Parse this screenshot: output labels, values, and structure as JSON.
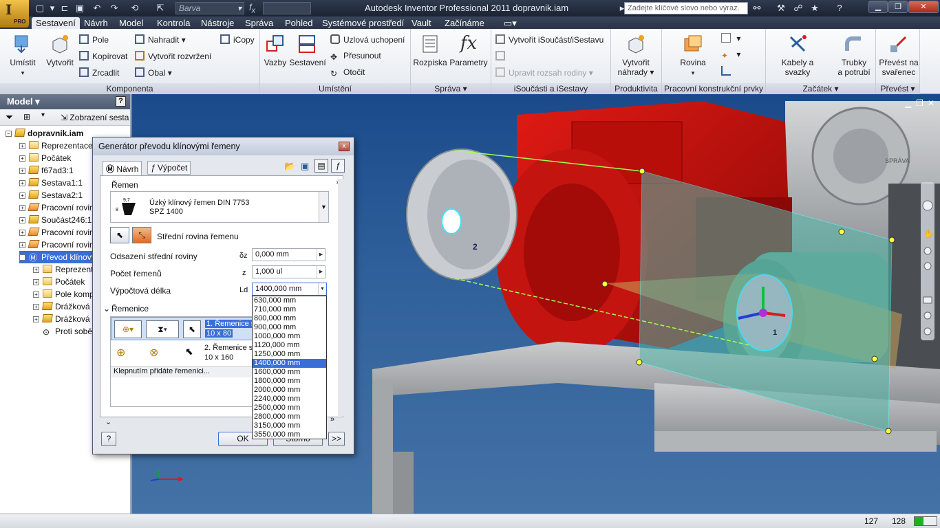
{
  "titlebar": {
    "title": "Autodesk Inventor Professional 2011   dopravnik.iam",
    "app_badge": "PRO",
    "color_field": "Barva",
    "search_placeholder": "Zadejte klíčové slovo nebo výraz."
  },
  "ribbon_tabs": [
    "Sestavení",
    "Návrh",
    "Model",
    "Kontrola",
    "Nástroje",
    "Správa",
    "Pohled",
    "Systémové prostředí",
    "Vault",
    "Začínáme"
  ],
  "ribbon": {
    "komponenta": {
      "label": "Komponenta",
      "umistit": "Umístit",
      "vytvorit": "Vytvořit",
      "pole": "Pole",
      "kopirovat": "Kopírovat",
      "zrcadlit": "Zrcadlit",
      "nahradit": "Nahradit",
      "vytvorit_rozvrzeni": "Vytvořit rozvržení",
      "obal": "Obal",
      "icopy": "iCopy"
    },
    "umisteni": {
      "label": "Umístění",
      "vazby": "Vazby",
      "sestaveni": "Sestavení",
      "uzlova": "Uzlová uchopení",
      "presunout": "Přesunout",
      "otocit": "Otočit"
    },
    "sprava": {
      "label": "Správa",
      "rozpiska": "Rozpiska",
      "parametry": "Parametry"
    },
    "isoucasti": {
      "label": "iSoučásti a iSestavy",
      "vytvorit": "Vytvořit iSoučást/iSestavu",
      "upravit": "Upravit rozsah rodiny"
    },
    "produktivita": {
      "label": "Produktivita",
      "vytvorit_nahrady_1": "Vytvořit",
      "vytvorit_nahrady_2": "náhrady"
    },
    "pracovni": {
      "label": "Pracovní konstrukční prvky",
      "rovina": "Rovina"
    },
    "zacatek": {
      "label": "Začátek",
      "kabely": "Kabely a svazky",
      "trubky_1": "Trubky",
      "trubky_2": "a potrubí"
    },
    "prevest": {
      "label": "Převést",
      "prevest_1": "Převést na",
      "prevest_2": "svařenec"
    }
  },
  "browser": {
    "title": "Model",
    "help": "?",
    "toolbar_view": "Zobrazení sesta",
    "tree": [
      {
        "label": "dopravnik.iam",
        "icon": "assembly-icon",
        "level": 0,
        "expander": "minus",
        "bold": true
      },
      {
        "label": "Reprezentace",
        "icon": "folder-icon",
        "level": 1,
        "expander": "plus"
      },
      {
        "label": "Počátek",
        "icon": "folder-icon",
        "level": 1,
        "expander": "plus"
      },
      {
        "label": "f67ad3:1",
        "icon": "part-icon",
        "level": 1,
        "expander": "plus"
      },
      {
        "label": "Sestava1:1",
        "icon": "subassembly-icon",
        "level": 1,
        "expander": "plus"
      },
      {
        "label": "Sestava2:1",
        "icon": "subassembly-icon",
        "level": 1,
        "expander": "plus"
      },
      {
        "label": "Pracovní rovina1",
        "icon": "plane-icon",
        "level": 1,
        "expander": "plus"
      },
      {
        "label": "Součást246:1",
        "icon": "part-icon",
        "level": 1,
        "expander": "plus"
      },
      {
        "label": "Pracovní rovina4",
        "icon": "plane-icon",
        "level": 1,
        "expander": "plus"
      },
      {
        "label": "Pracovní rovina5",
        "icon": "plane-icon",
        "level": 1,
        "expander": "plus"
      },
      {
        "label": "Převod klínovým ř",
        "icon": "design-accelerator-icon",
        "level": 1,
        "expander": "minus",
        "selected": true
      },
      {
        "label": "Reprezentace",
        "icon": "folder-icon",
        "level": 2,
        "expander": "plus"
      },
      {
        "label": "Počátek",
        "icon": "folder-icon",
        "level": 2,
        "expander": "plus"
      },
      {
        "label": "Pole komponen",
        "icon": "pattern-icon",
        "level": 2,
        "expander": "plus"
      },
      {
        "label": "Drážková řeme",
        "icon": "part-icon",
        "level": 2,
        "expander": "plus"
      },
      {
        "label": "Drážková řeme",
        "icon": "part-icon",
        "level": 2,
        "expander": "plus"
      },
      {
        "label": "Proti sobě:9",
        "icon": "constraint-icon",
        "level": 2,
        "expander": "none"
      }
    ]
  },
  "viewport": {
    "pulley_label": "2",
    "pulley_label_right": "1",
    "gearbox_text": "SPRÁVA"
  },
  "dialog": {
    "title": "Generátor převodu klínovými řemeny",
    "close": "x",
    "tab_navrh": "Návrh",
    "tab_vypocet": "Výpočet",
    "section_remen": "Řemen",
    "belt_dim_top": "9,7",
    "belt_dim_side": "8",
    "belt_name": "Úzký klínový řemen DIN 7753",
    "belt_size": "SPZ 1400",
    "midplane_label": "Střední rovina řemenu",
    "odsazeni_label": "Odsazení střední roviny",
    "odsazeni_sym": "δz",
    "odsazeni_value": "0,000 mm",
    "pocet_label": "Počet řemenů",
    "pocet_sym": "z",
    "pocet_value": "1,000 ul",
    "delka_label": "Výpočtová délka",
    "delka_sym": "Ld",
    "delka_value": "1400,000 mm",
    "section_remenice": "Řemenice",
    "pulley1_line1": "1. Řemenice s",
    "pulley1_line2": "10 x 80",
    "pulley2_line1": "2. Řemenice s",
    "pulley2_line2": "10 x 160",
    "add_pulley": "Klepnutím přidáte řemenici...",
    "ok": "OK",
    "cancel": "Storno",
    "more": ">>",
    "help": "?"
  },
  "dropdown": {
    "options": [
      "630,000 mm",
      "710,000 mm",
      "800,000 mm",
      "900,000 mm",
      "1000,000 mm",
      "1120,000 mm",
      "1250,000 mm",
      "1400,000 mm",
      "1600,000 mm",
      "1800,000 mm",
      "2000,000 mm",
      "2240,000 mm",
      "2500,000 mm",
      "2800,000 mm",
      "3150,000 mm",
      "3550,000 mm"
    ],
    "selected": "1400,000 mm"
  },
  "statusbar": {
    "count_a": "127",
    "count_b": "128"
  },
  "colors": {
    "gearbox": "#c8100c",
    "plane": "#52b7a8",
    "selection": "#3a6fd8",
    "viewport_top": "#1a4a8a"
  }
}
